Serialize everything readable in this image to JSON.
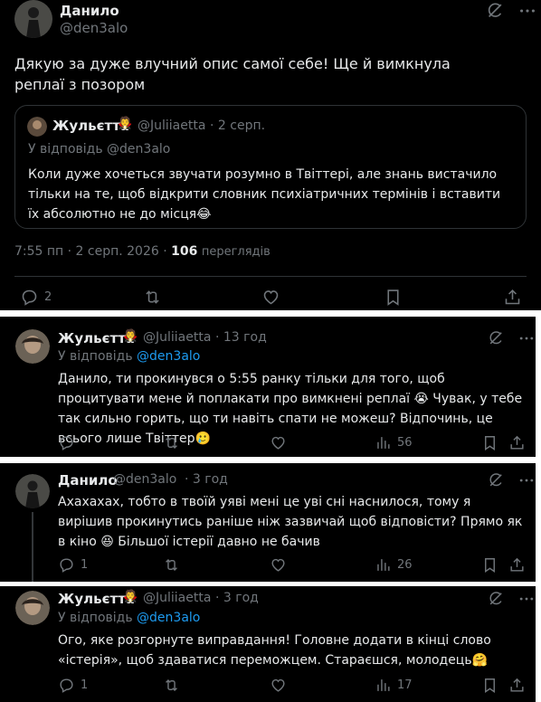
{
  "main_tweet": {
    "author_name": "Данило",
    "author_handle": "@den3alo",
    "text": "Дякую за дуже влучний опис самої себе! Ще й вимкнула реплаї з позором",
    "quote": {
      "author_name": "Жульєтта",
      "author_handle": "@Juliiaetta",
      "date": "· 2 серп.",
      "reply_prefix": "У відповідь",
      "reply_to": "@den3alo",
      "text": "Коли дуже хочеться звучати розумно в Твіттері, але знань вистачило тільки на те, щоб відкрити словник психіатричних термінів і вставити їх абсолютно не до місця😂"
    },
    "timestamp": "7:55 пп · 2 серп. 2026 ·",
    "views_count": "106",
    "views_label": "переглядів",
    "replies": "2"
  },
  "replies": [
    {
      "author_name": "Жульєтта",
      "author_handle": "@Juliiaetta",
      "time": "· 13 год",
      "reply_prefix": "У відповідь",
      "reply_to": "@den3alo",
      "text": "Данило, ти прокинувся о 5:55 ранку тільки для того, щоб процитувати мене й поплакати про вимкнені реплаї 😭 Чувак, у тебе так сильно горить, що ти навіть спати не можеш? Відпочинь, це всього лише Твіттер🥲",
      "comments": "",
      "views": "56"
    },
    {
      "author_name": "Данило",
      "author_handle": "@den3alo",
      "time": "· 3 год",
      "text": "Ахахахах, тобто в твоїй уяві мені це уві сні наснилося, тому я вирішив прокинутись раніше ніж зазвичай щоб відповісти? Прямо як в кіно 😆 Більшої істерії давно не бачив",
      "comments": "1",
      "views": "26"
    },
    {
      "author_name": "Жульєтта",
      "author_handle": "@Juliiaetta",
      "time": "· 3 год",
      "reply_prefix": "У відповідь",
      "reply_to": "@den3alo",
      "text": "Ого, яке розгорнуте виправдання! Головне додати в кінці слово «істерія», щоб здаватися переможцем. Стараєшся, молодець🤗",
      "comments": "1",
      "views": "17"
    }
  ],
  "icons": [
    "grok-icon",
    "more-icon",
    "reply-icon",
    "retweet-icon",
    "like-icon",
    "views-icon",
    "bookmark-icon",
    "share-icon"
  ],
  "colors": {
    "link": "#1d9bf0",
    "muted": "#71767b",
    "text": "#e7e9ea",
    "border": "#2f3336"
  }
}
